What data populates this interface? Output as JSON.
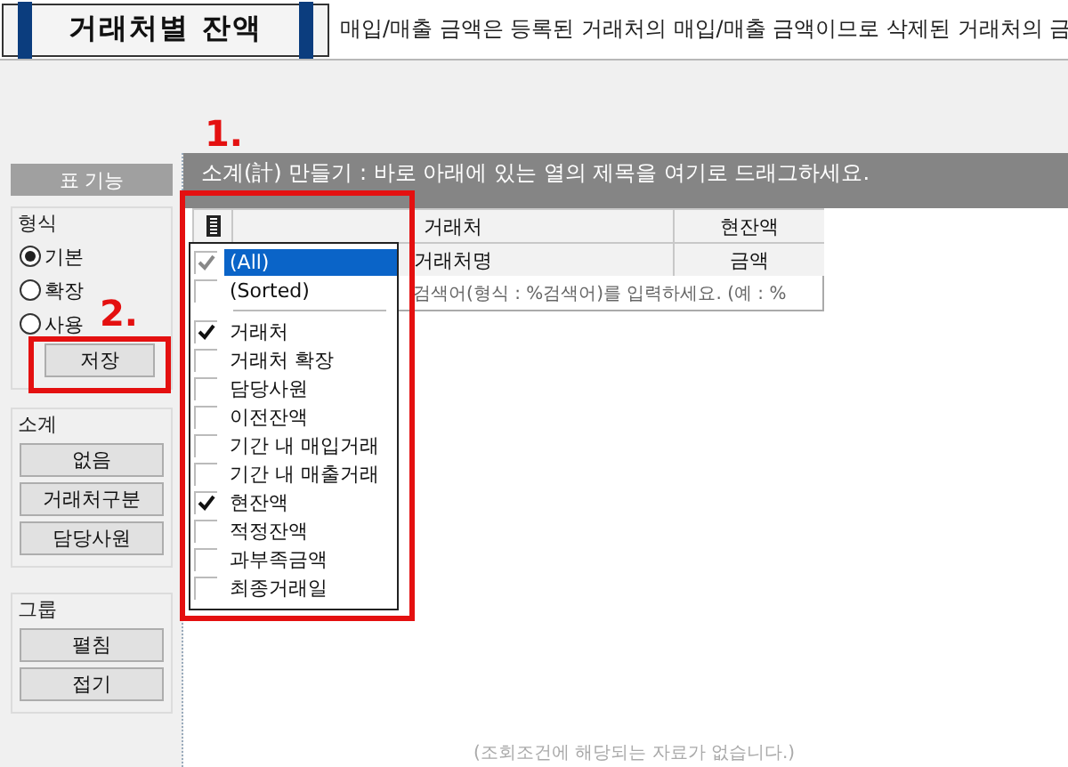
{
  "header": {
    "title": "거래처별 잔액",
    "notice": "매입/매출 금액은 등록된 거래처의 매입/매출 금액이므로 삭제된 거래처의 금"
  },
  "side_panel": {
    "title": "표 기능",
    "format": {
      "label": "형식",
      "options": [
        {
          "label": "기본",
          "selected": true
        },
        {
          "label": "확장",
          "selected": false
        },
        {
          "label": "사용",
          "selected": false
        }
      ],
      "save_button": "저장"
    },
    "subtotal": {
      "label": "소계",
      "buttons": [
        "없음",
        "거래처구분",
        "담당사원"
      ]
    },
    "group": {
      "label": "그룹",
      "buttons": [
        "펼침",
        "접기"
      ]
    }
  },
  "group_bar": {
    "hint": "소계(計) 만들기 : 바로 아래에 있는 열의 제목을 여기로 드래그하세요."
  },
  "grid": {
    "header_row_1": [
      "거래처",
      "현잔액"
    ],
    "header_row_2": [
      "거래처명",
      "금액"
    ],
    "filter_hint": "검색어(형식 : %검색어)를 입력하세요. (예 : %"
  },
  "column_menu": {
    "top_items": [
      {
        "label": "(All)",
        "checked": true,
        "selected": true
      },
      {
        "label": "(Sorted)",
        "checked": false,
        "selected": false
      }
    ],
    "items": [
      {
        "label": "거래처",
        "checked": true
      },
      {
        "label": "거래처 확장",
        "checked": false
      },
      {
        "label": "담당사원",
        "checked": false
      },
      {
        "label": "이전잔액",
        "checked": false
      },
      {
        "label": "기간 내 매입거래",
        "checked": false
      },
      {
        "label": "기간 내 매출거래",
        "checked": false
      },
      {
        "label": "현잔액",
        "checked": true
      },
      {
        "label": "적정잔액",
        "checked": false
      },
      {
        "label": "과부족금액",
        "checked": false
      },
      {
        "label": "최종거래일",
        "checked": false
      }
    ]
  },
  "empty_message": "(조회조건에 해당되는 자료가 없습니다.)",
  "annotations": [
    {
      "label": "1."
    },
    {
      "label": "2."
    }
  ]
}
